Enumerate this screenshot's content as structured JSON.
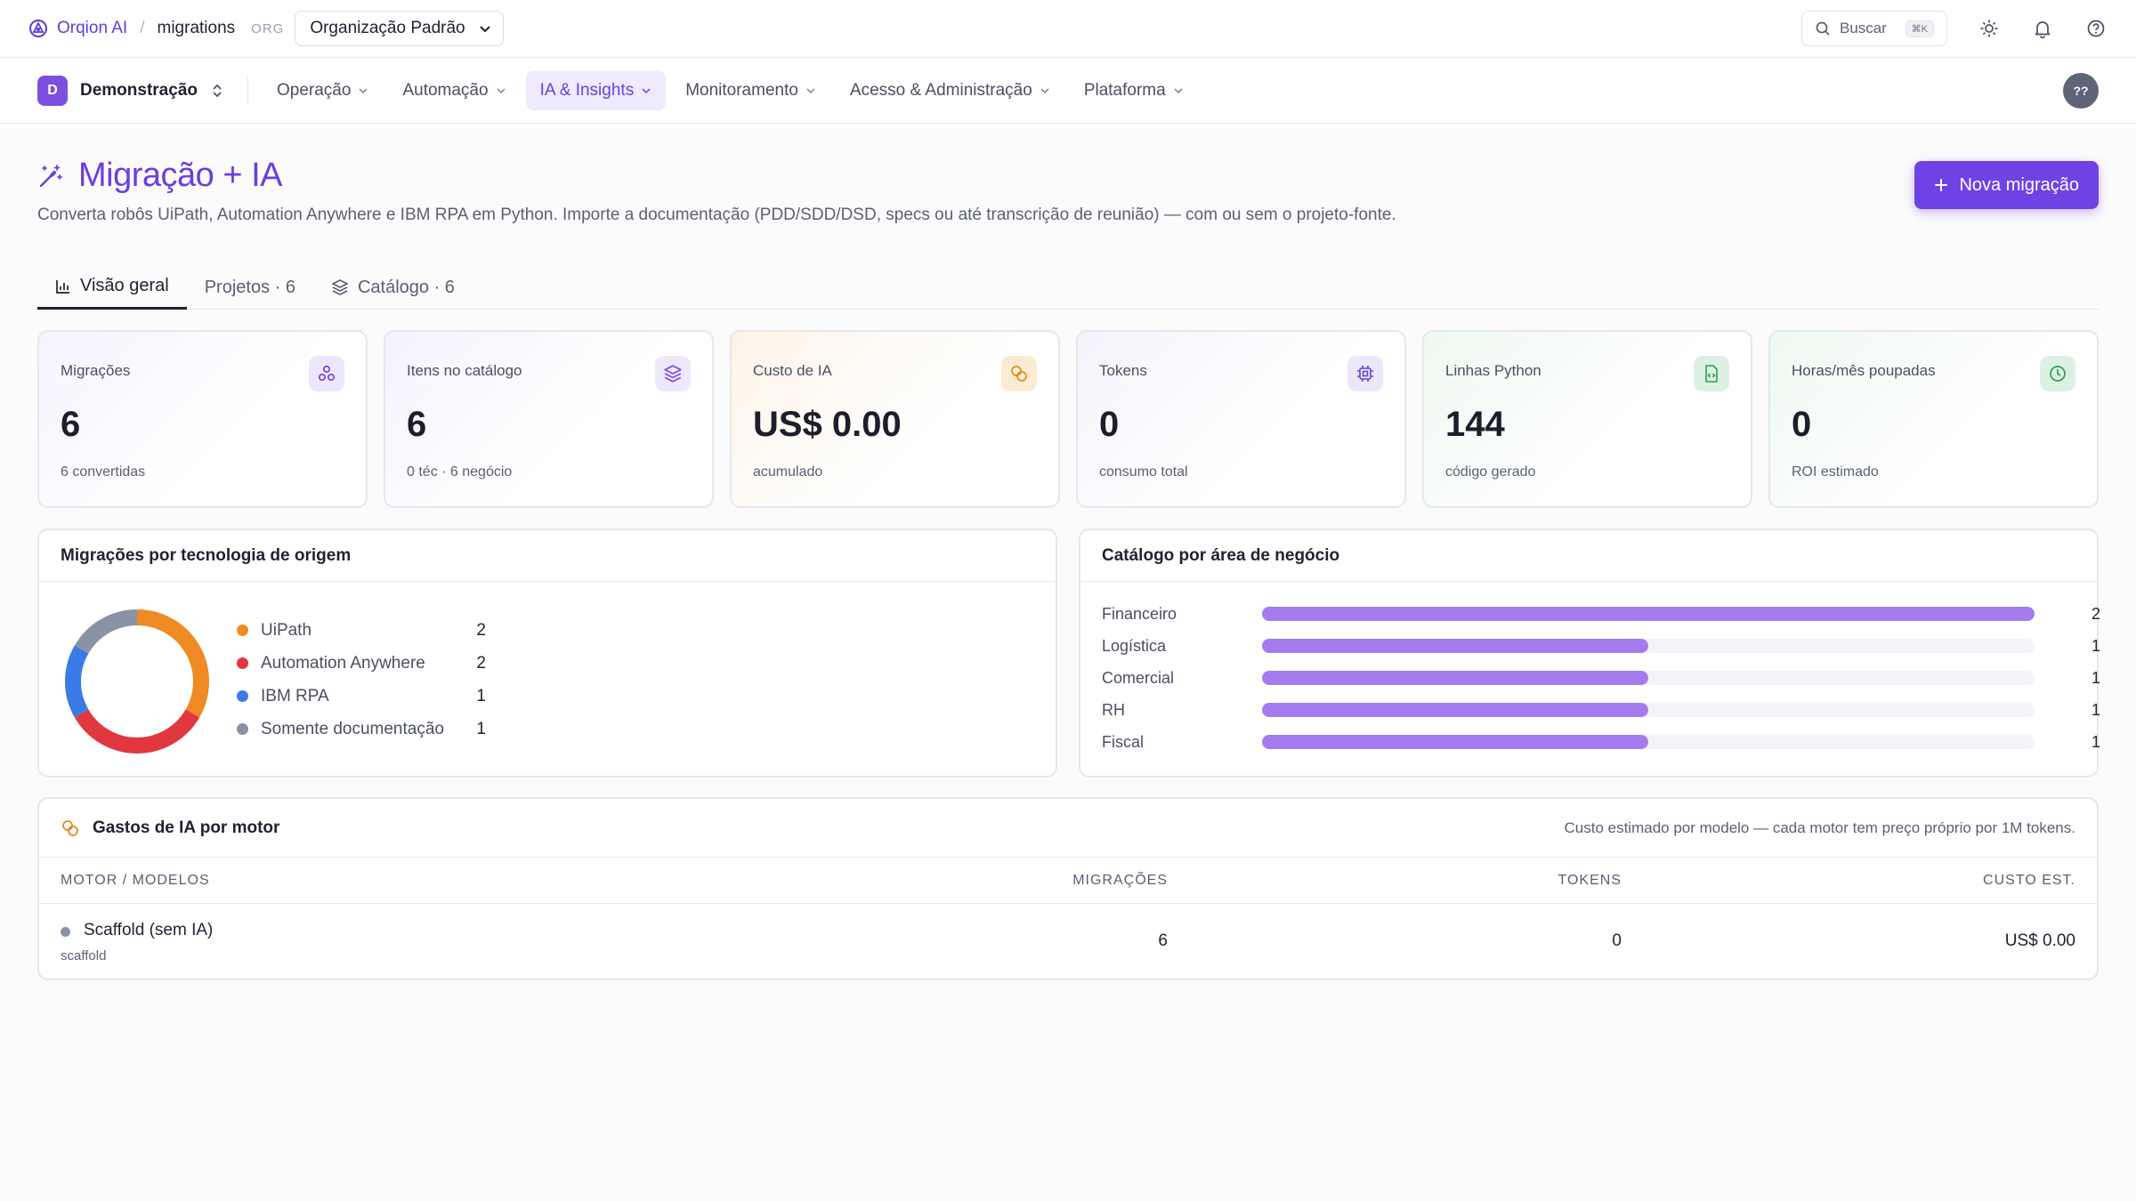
{
  "topbar": {
    "brand": "Orqion AI",
    "separator": "/",
    "crumb": "migrations",
    "org_label": "ORG",
    "org_value": "Organização Padrão",
    "search_label": "Buscar",
    "search_kbd": "⌘K"
  },
  "nav": {
    "workspace_initial": "D",
    "workspace_name": "Demonstração",
    "items": [
      {
        "label": "Operação"
      },
      {
        "label": "Automação"
      },
      {
        "label": "IA & Insights"
      },
      {
        "label": "Monitoramento"
      },
      {
        "label": "Acesso & Administração"
      },
      {
        "label": "Plataforma"
      }
    ],
    "avatar": "??"
  },
  "header": {
    "title": "Migração + IA",
    "subtitle": "Converta robôs UiPath, Automation Anywhere e IBM RPA em Python. Importe a documentação (PDD/SDD/DSD, specs ou até transcrição de reunião) — com ou sem o projeto-fonte.",
    "new_button": "Nova migração"
  },
  "tabs": [
    {
      "label": "Visão geral"
    },
    {
      "label": "Projetos · 6"
    },
    {
      "label": "Catálogo · 6"
    }
  ],
  "stats": [
    {
      "label": "Migrações",
      "value": "6",
      "hint": "6 convertidas",
      "icon": "nodes-icon",
      "color": "#6b3fdc"
    },
    {
      "label": "Itens no catálogo",
      "value": "6",
      "hint": "0 téc · 6 negócio",
      "icon": "layers-icon",
      "color": "#7c4fe0"
    },
    {
      "label": "Custo de IA",
      "value": "US$ 0.00",
      "hint": "acumulado",
      "icon": "coins-icon",
      "color": "#e08a1c"
    },
    {
      "label": "Tokens",
      "value": "0",
      "hint": "consumo total",
      "icon": "chip-icon",
      "color": "#6b3fdc"
    },
    {
      "label": "Linhas Python",
      "value": "144",
      "hint": "código gerado",
      "icon": "code-file-icon",
      "color": "#2f9e5b"
    },
    {
      "label": "Horas/mês poupadas",
      "value": "0",
      "hint": "ROI estimado",
      "icon": "clock-icon",
      "color": "#2f9e5b"
    }
  ],
  "tech_panel": {
    "title": "Migrações por tecnologia de origem"
  },
  "catalog_panel": {
    "title": "Catálogo por área de negócio"
  },
  "chart_data": [
    {
      "type": "pie",
      "title": "Migrações por tecnologia de origem",
      "categories": [
        "UiPath",
        "Automation Anywhere",
        "IBM RPA",
        "Somente documentação"
      ],
      "values": [
        2,
        2,
        1,
        1
      ],
      "colors": [
        "#f08a24",
        "#e0383e",
        "#3b7be8",
        "#8a93a6"
      ]
    },
    {
      "type": "bar",
      "title": "Catálogo por área de negócio",
      "categories": [
        "Financeiro",
        "Logística",
        "Comercial",
        "RH",
        "Fiscal"
      ],
      "values": [
        2,
        1,
        1,
        1,
        1
      ],
      "xlim": [
        0,
        2
      ],
      "color": "#a47cf0"
    }
  ],
  "spend": {
    "title": "Gastos de IA por motor",
    "note": "Custo estimado por modelo — cada motor tem preço próprio por 1M tokens.",
    "columns": [
      "MOTOR / MODELOS",
      "MIGRAÇÕES",
      "TOKENS",
      "CUSTO EST."
    ],
    "rows": [
      {
        "motor": "Scaffold (sem IA)",
        "model": "scaffold",
        "migrations": "6",
        "tokens": "0",
        "cost": "US$ 0.00"
      }
    ]
  }
}
